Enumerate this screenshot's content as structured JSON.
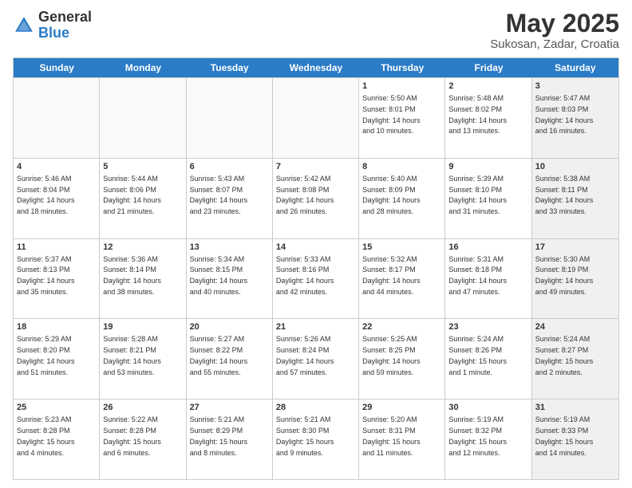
{
  "logo": {
    "general": "General",
    "blue": "Blue"
  },
  "title": {
    "month_year": "May 2025",
    "location": "Sukosan, Zadar, Croatia"
  },
  "calendar": {
    "days_of_week": [
      "Sunday",
      "Monday",
      "Tuesday",
      "Wednesday",
      "Thursday",
      "Friday",
      "Saturday"
    ],
    "weeks": [
      [
        {
          "day": "",
          "info": "",
          "shaded": true
        },
        {
          "day": "",
          "info": "",
          "shaded": true
        },
        {
          "day": "",
          "info": "",
          "shaded": true
        },
        {
          "day": "",
          "info": "",
          "shaded": true
        },
        {
          "day": "1",
          "info": "Sunrise: 5:50 AM\nSunset: 8:01 PM\nDaylight: 14 hours\nand 10 minutes.",
          "shaded": false
        },
        {
          "day": "2",
          "info": "Sunrise: 5:48 AM\nSunset: 8:02 PM\nDaylight: 14 hours\nand 13 minutes.",
          "shaded": false
        },
        {
          "day": "3",
          "info": "Sunrise: 5:47 AM\nSunset: 8:03 PM\nDaylight: 14 hours\nand 16 minutes.",
          "shaded": true
        }
      ],
      [
        {
          "day": "4",
          "info": "Sunrise: 5:46 AM\nSunset: 8:04 PM\nDaylight: 14 hours\nand 18 minutes.",
          "shaded": false
        },
        {
          "day": "5",
          "info": "Sunrise: 5:44 AM\nSunset: 8:06 PM\nDaylight: 14 hours\nand 21 minutes.",
          "shaded": false
        },
        {
          "day": "6",
          "info": "Sunrise: 5:43 AM\nSunset: 8:07 PM\nDaylight: 14 hours\nand 23 minutes.",
          "shaded": false
        },
        {
          "day": "7",
          "info": "Sunrise: 5:42 AM\nSunset: 8:08 PM\nDaylight: 14 hours\nand 26 minutes.",
          "shaded": false
        },
        {
          "day": "8",
          "info": "Sunrise: 5:40 AM\nSunset: 8:09 PM\nDaylight: 14 hours\nand 28 minutes.",
          "shaded": false
        },
        {
          "day": "9",
          "info": "Sunrise: 5:39 AM\nSunset: 8:10 PM\nDaylight: 14 hours\nand 31 minutes.",
          "shaded": false
        },
        {
          "day": "10",
          "info": "Sunrise: 5:38 AM\nSunset: 8:11 PM\nDaylight: 14 hours\nand 33 minutes.",
          "shaded": true
        }
      ],
      [
        {
          "day": "11",
          "info": "Sunrise: 5:37 AM\nSunset: 8:13 PM\nDaylight: 14 hours\nand 35 minutes.",
          "shaded": false
        },
        {
          "day": "12",
          "info": "Sunrise: 5:36 AM\nSunset: 8:14 PM\nDaylight: 14 hours\nand 38 minutes.",
          "shaded": false
        },
        {
          "day": "13",
          "info": "Sunrise: 5:34 AM\nSunset: 8:15 PM\nDaylight: 14 hours\nand 40 minutes.",
          "shaded": false
        },
        {
          "day": "14",
          "info": "Sunrise: 5:33 AM\nSunset: 8:16 PM\nDaylight: 14 hours\nand 42 minutes.",
          "shaded": false
        },
        {
          "day": "15",
          "info": "Sunrise: 5:32 AM\nSunset: 8:17 PM\nDaylight: 14 hours\nand 44 minutes.",
          "shaded": false
        },
        {
          "day": "16",
          "info": "Sunrise: 5:31 AM\nSunset: 8:18 PM\nDaylight: 14 hours\nand 47 minutes.",
          "shaded": false
        },
        {
          "day": "17",
          "info": "Sunrise: 5:30 AM\nSunset: 8:19 PM\nDaylight: 14 hours\nand 49 minutes.",
          "shaded": true
        }
      ],
      [
        {
          "day": "18",
          "info": "Sunrise: 5:29 AM\nSunset: 8:20 PM\nDaylight: 14 hours\nand 51 minutes.",
          "shaded": false
        },
        {
          "day": "19",
          "info": "Sunrise: 5:28 AM\nSunset: 8:21 PM\nDaylight: 14 hours\nand 53 minutes.",
          "shaded": false
        },
        {
          "day": "20",
          "info": "Sunrise: 5:27 AM\nSunset: 8:22 PM\nDaylight: 14 hours\nand 55 minutes.",
          "shaded": false
        },
        {
          "day": "21",
          "info": "Sunrise: 5:26 AM\nSunset: 8:24 PM\nDaylight: 14 hours\nand 57 minutes.",
          "shaded": false
        },
        {
          "day": "22",
          "info": "Sunrise: 5:25 AM\nSunset: 8:25 PM\nDaylight: 14 hours\nand 59 minutes.",
          "shaded": false
        },
        {
          "day": "23",
          "info": "Sunrise: 5:24 AM\nSunset: 8:26 PM\nDaylight: 15 hours\nand 1 minute.",
          "shaded": false
        },
        {
          "day": "24",
          "info": "Sunrise: 5:24 AM\nSunset: 8:27 PM\nDaylight: 15 hours\nand 2 minutes.",
          "shaded": true
        }
      ],
      [
        {
          "day": "25",
          "info": "Sunrise: 5:23 AM\nSunset: 8:28 PM\nDaylight: 15 hours\nand 4 minutes.",
          "shaded": false
        },
        {
          "day": "26",
          "info": "Sunrise: 5:22 AM\nSunset: 8:28 PM\nDaylight: 15 hours\nand 6 minutes.",
          "shaded": false
        },
        {
          "day": "27",
          "info": "Sunrise: 5:21 AM\nSunset: 8:29 PM\nDaylight: 15 hours\nand 8 minutes.",
          "shaded": false
        },
        {
          "day": "28",
          "info": "Sunrise: 5:21 AM\nSunset: 8:30 PM\nDaylight: 15 hours\nand 9 minutes.",
          "shaded": false
        },
        {
          "day": "29",
          "info": "Sunrise: 5:20 AM\nSunset: 8:31 PM\nDaylight: 15 hours\nand 11 minutes.",
          "shaded": false
        },
        {
          "day": "30",
          "info": "Sunrise: 5:19 AM\nSunset: 8:32 PM\nDaylight: 15 hours\nand 12 minutes.",
          "shaded": false
        },
        {
          "day": "31",
          "info": "Sunrise: 5:19 AM\nSunset: 8:33 PM\nDaylight: 15 hours\nand 14 minutes.",
          "shaded": true
        }
      ]
    ]
  }
}
